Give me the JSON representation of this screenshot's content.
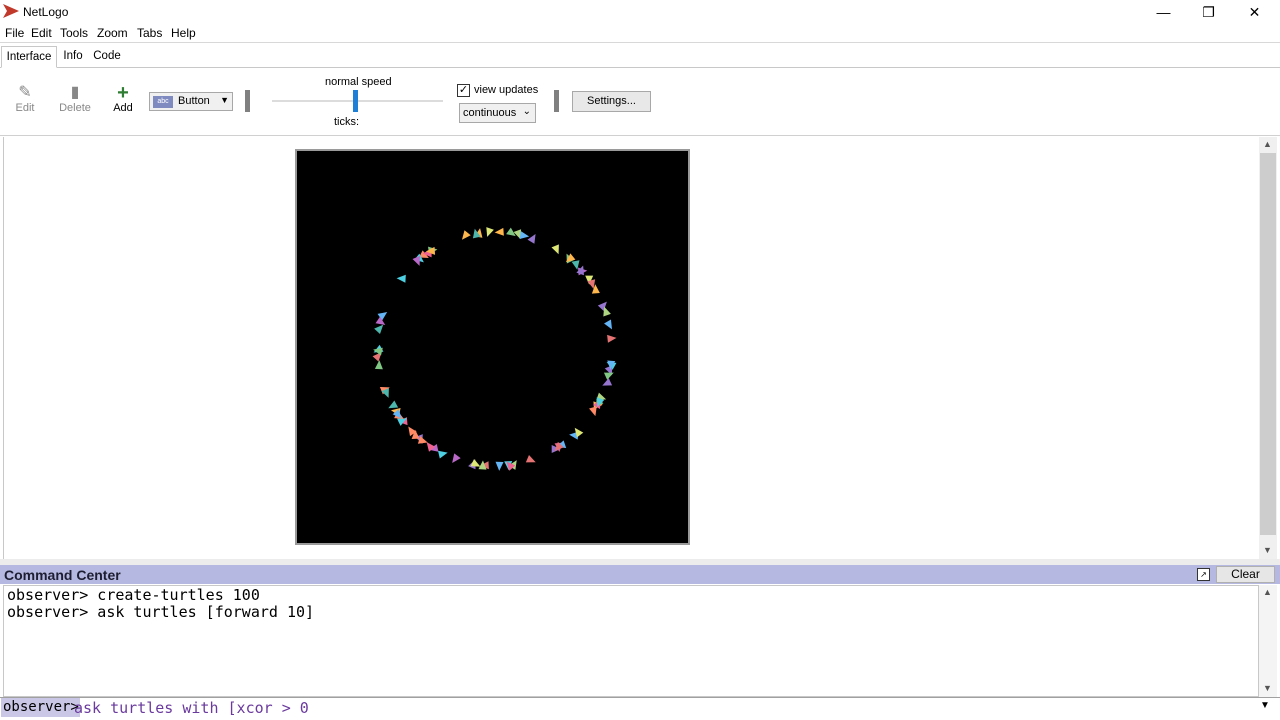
{
  "app": {
    "title": "NetLogo",
    "logo_icon": "netlogo-logo-icon",
    "accent": "#c0392b"
  },
  "window_controls": {
    "minimize_icon": "minimize-icon",
    "maximize_icon": "restore-icon",
    "close_icon": "close-icon"
  },
  "menu": [
    "File",
    "Edit",
    "Tools",
    "Zoom",
    "Tabs",
    "Help"
  ],
  "tabs": [
    {
      "label": "Interface",
      "active": true
    },
    {
      "label": "Info",
      "active": false
    },
    {
      "label": "Code",
      "active": false
    }
  ],
  "toolbar": {
    "edit_label": "Edit",
    "delete_label": "Delete",
    "add_label": "Add",
    "widget_type": "Button",
    "widget_icon_text": "abc",
    "speed_label": "normal speed",
    "speed_level": 0.5,
    "ticks_label": "ticks:",
    "view_updates_label": "view updates",
    "view_updates_checked": true,
    "update_mode": "continuous",
    "settings_label": "Settings..."
  },
  "world": {
    "background": "#000000",
    "turtle_count_shown": "ring of turtles"
  },
  "command_center": {
    "title": "Command Center",
    "clear_label": "Clear",
    "header_color": "#b5b8e0",
    "output_lines": [
      "observer> create-turtles 100",
      "observer> ask turtles [forward 10]"
    ],
    "agent_prompt": "observer>",
    "input_value": "ask turtles with [xcor > 0"
  }
}
